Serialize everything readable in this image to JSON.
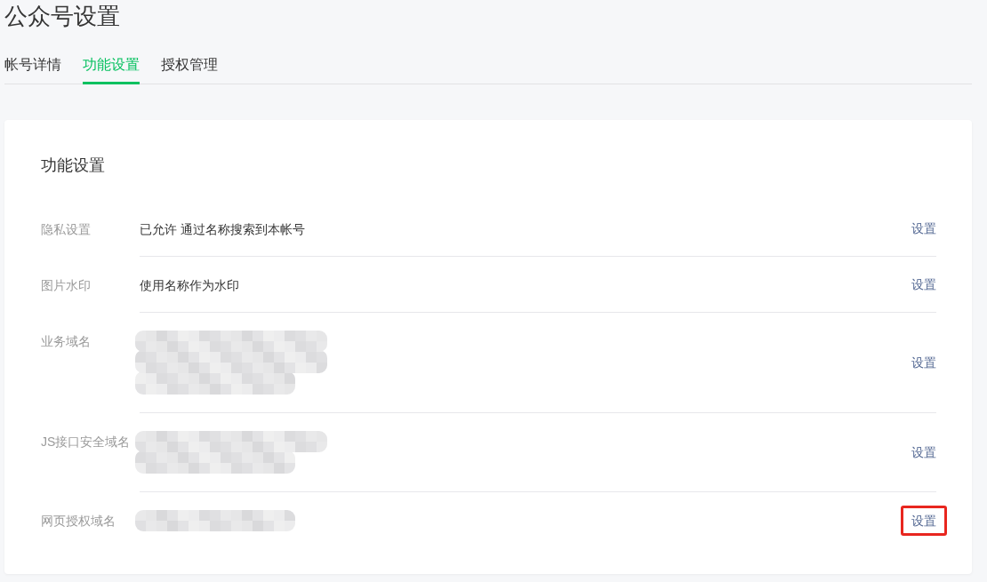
{
  "page_title": "公众号设置",
  "tabs": [
    {
      "label": "帐号详情",
      "selected": false
    },
    {
      "label": "功能设置",
      "selected": true
    },
    {
      "label": "授权管理",
      "selected": false
    }
  ],
  "panel": {
    "title": "功能设置",
    "rows": [
      {
        "label": "隐私设置",
        "kind": "text",
        "value": "已允许 通过名称搜索到本帐号",
        "action": "设置",
        "highlighted": false
      },
      {
        "label": "图片水印",
        "kind": "text",
        "value": "使用名称作为水印",
        "action": "设置",
        "highlighted": false
      },
      {
        "label": "业务域名",
        "kind": "redacted",
        "blur_lines": [
          {
            "kind": "wide"
          },
          {
            "kind": "wide"
          },
          {
            "kind": "narrow"
          }
        ],
        "action": "设置",
        "highlighted": false
      },
      {
        "label": "JS接口安全域名",
        "kind": "redacted",
        "blur_lines": [
          {
            "kind": "wide"
          },
          {
            "kind": "narrow"
          }
        ],
        "action": "设置",
        "highlighted": false
      },
      {
        "label": "网页授权域名",
        "kind": "redacted",
        "blur_lines": [
          {
            "kind": "narrow"
          }
        ],
        "action": "设置",
        "highlighted": true
      }
    ]
  }
}
